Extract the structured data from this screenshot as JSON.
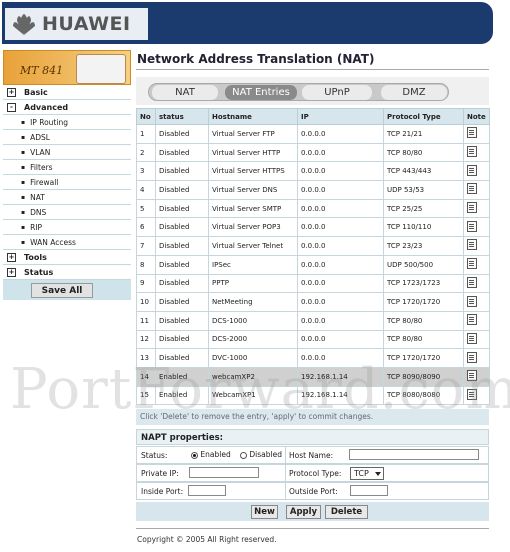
{
  "brand": {
    "name": "HUAWEI",
    "model": "MT 841"
  },
  "sidebar": {
    "items": [
      {
        "label": "Basic",
        "type": "top",
        "box": "+"
      },
      {
        "label": "Advanced",
        "type": "top",
        "box": "-"
      },
      {
        "label": "IP Routing",
        "type": "sub"
      },
      {
        "label": "ADSL",
        "type": "sub"
      },
      {
        "label": "VLAN",
        "type": "sub"
      },
      {
        "label": "Filters",
        "type": "sub"
      },
      {
        "label": "Firewall",
        "type": "sub"
      },
      {
        "label": "NAT",
        "type": "sub"
      },
      {
        "label": "DNS",
        "type": "sub"
      },
      {
        "label": "RIP",
        "type": "sub"
      },
      {
        "label": "WAN Access",
        "type": "sub"
      },
      {
        "label": "Tools",
        "type": "top",
        "box": "+"
      },
      {
        "label": "Status",
        "type": "top",
        "box": "+"
      }
    ],
    "save_all": "Save All"
  },
  "page": {
    "title": "Network Address Translation (NAT)"
  },
  "tabs": [
    {
      "label": "NAT",
      "active": false
    },
    {
      "label": "NAT Entries",
      "active": true
    },
    {
      "label": "UPnP",
      "active": false
    },
    {
      "label": "DMZ",
      "active": false
    }
  ],
  "table": {
    "headers": [
      "No",
      "status",
      "Hostname",
      "IP",
      "Protocol Type",
      "Note"
    ],
    "rows": [
      {
        "no": "1",
        "status": "Disabled",
        "hostname": "Virtual Server FTP",
        "ip": "0.0.0.0",
        "proto": "TCP  21/21",
        "highlight": false
      },
      {
        "no": "2",
        "status": "Disabled",
        "hostname": "Virtual Server HTTP",
        "ip": "0.0.0.0",
        "proto": "TCP  80/80",
        "highlight": false
      },
      {
        "no": "3",
        "status": "Disabled",
        "hostname": "Virtual Server HTTPS",
        "ip": "0.0.0.0",
        "proto": "TCP  443/443",
        "highlight": false
      },
      {
        "no": "4",
        "status": "Disabled",
        "hostname": "Virtual Server DNS",
        "ip": "0.0.0.0",
        "proto": "UDP  53/53",
        "highlight": false
      },
      {
        "no": "5",
        "status": "Disabled",
        "hostname": "Virtual Server SMTP",
        "ip": "0.0.0.0",
        "proto": "TCP  25/25",
        "highlight": false
      },
      {
        "no": "6",
        "status": "Disabled",
        "hostname": "Virtual Server POP3",
        "ip": "0.0.0.0",
        "proto": "TCP  110/110",
        "highlight": false
      },
      {
        "no": "7",
        "status": "Disabled",
        "hostname": "Virtual Server Telnet",
        "ip": "0.0.0.0",
        "proto": "TCP  23/23",
        "highlight": false
      },
      {
        "no": "8",
        "status": "Disabled",
        "hostname": "IPSec",
        "ip": "0.0.0.0",
        "proto": "UDP  500/500",
        "highlight": false
      },
      {
        "no": "9",
        "status": "Disabled",
        "hostname": "PPTP",
        "ip": "0.0.0.0",
        "proto": "TCP  1723/1723",
        "highlight": false
      },
      {
        "no": "10",
        "status": "Disabled",
        "hostname": "NetMeeting",
        "ip": "0.0.0.0",
        "proto": "TCP  1720/1720",
        "highlight": false
      },
      {
        "no": "11",
        "status": "Disabled",
        "hostname": "DCS-1000",
        "ip": "0.0.0.0",
        "proto": "TCP  80/80",
        "highlight": false
      },
      {
        "no": "12",
        "status": "Disabled",
        "hostname": "DCS-2000",
        "ip": "0.0.0.0",
        "proto": "TCP  80/80",
        "highlight": false
      },
      {
        "no": "13",
        "status": "Disabled",
        "hostname": "DVC-1000",
        "ip": "0.0.0.0",
        "proto": "TCP  1720/1720",
        "highlight": false
      },
      {
        "no": "14",
        "status": "Enabled",
        "hostname": "webcamXP2",
        "ip": "192.168.1.14",
        "proto": "TCP  8090/8090",
        "highlight": true
      },
      {
        "no": "15",
        "status": "Enabled",
        "hostname": "WebcamXP1",
        "ip": "192.168.1.14",
        "proto": "TCP  8080/8080",
        "highlight": false
      }
    ]
  },
  "hint": "Click 'Delete' to remove the entry, 'apply' to commit changes.",
  "napt": {
    "title": "NAPT properties:",
    "status_label": "Status:",
    "enabled_label": "Enabled",
    "disabled_label": "Disabled",
    "hostname_label": "Host Name:",
    "private_ip_label": "Private IP:",
    "protocol_label": "Protocol Type:",
    "protocol_value": "TCP",
    "inside_port_label": "Inside Port:",
    "outside_port_label": "Outside Port:"
  },
  "buttons": {
    "new": "New",
    "apply": "Apply",
    "delete": "Delete"
  },
  "footer": "Copyright © 2005 All Right reserved.",
  "watermark": "PortForward.com"
}
